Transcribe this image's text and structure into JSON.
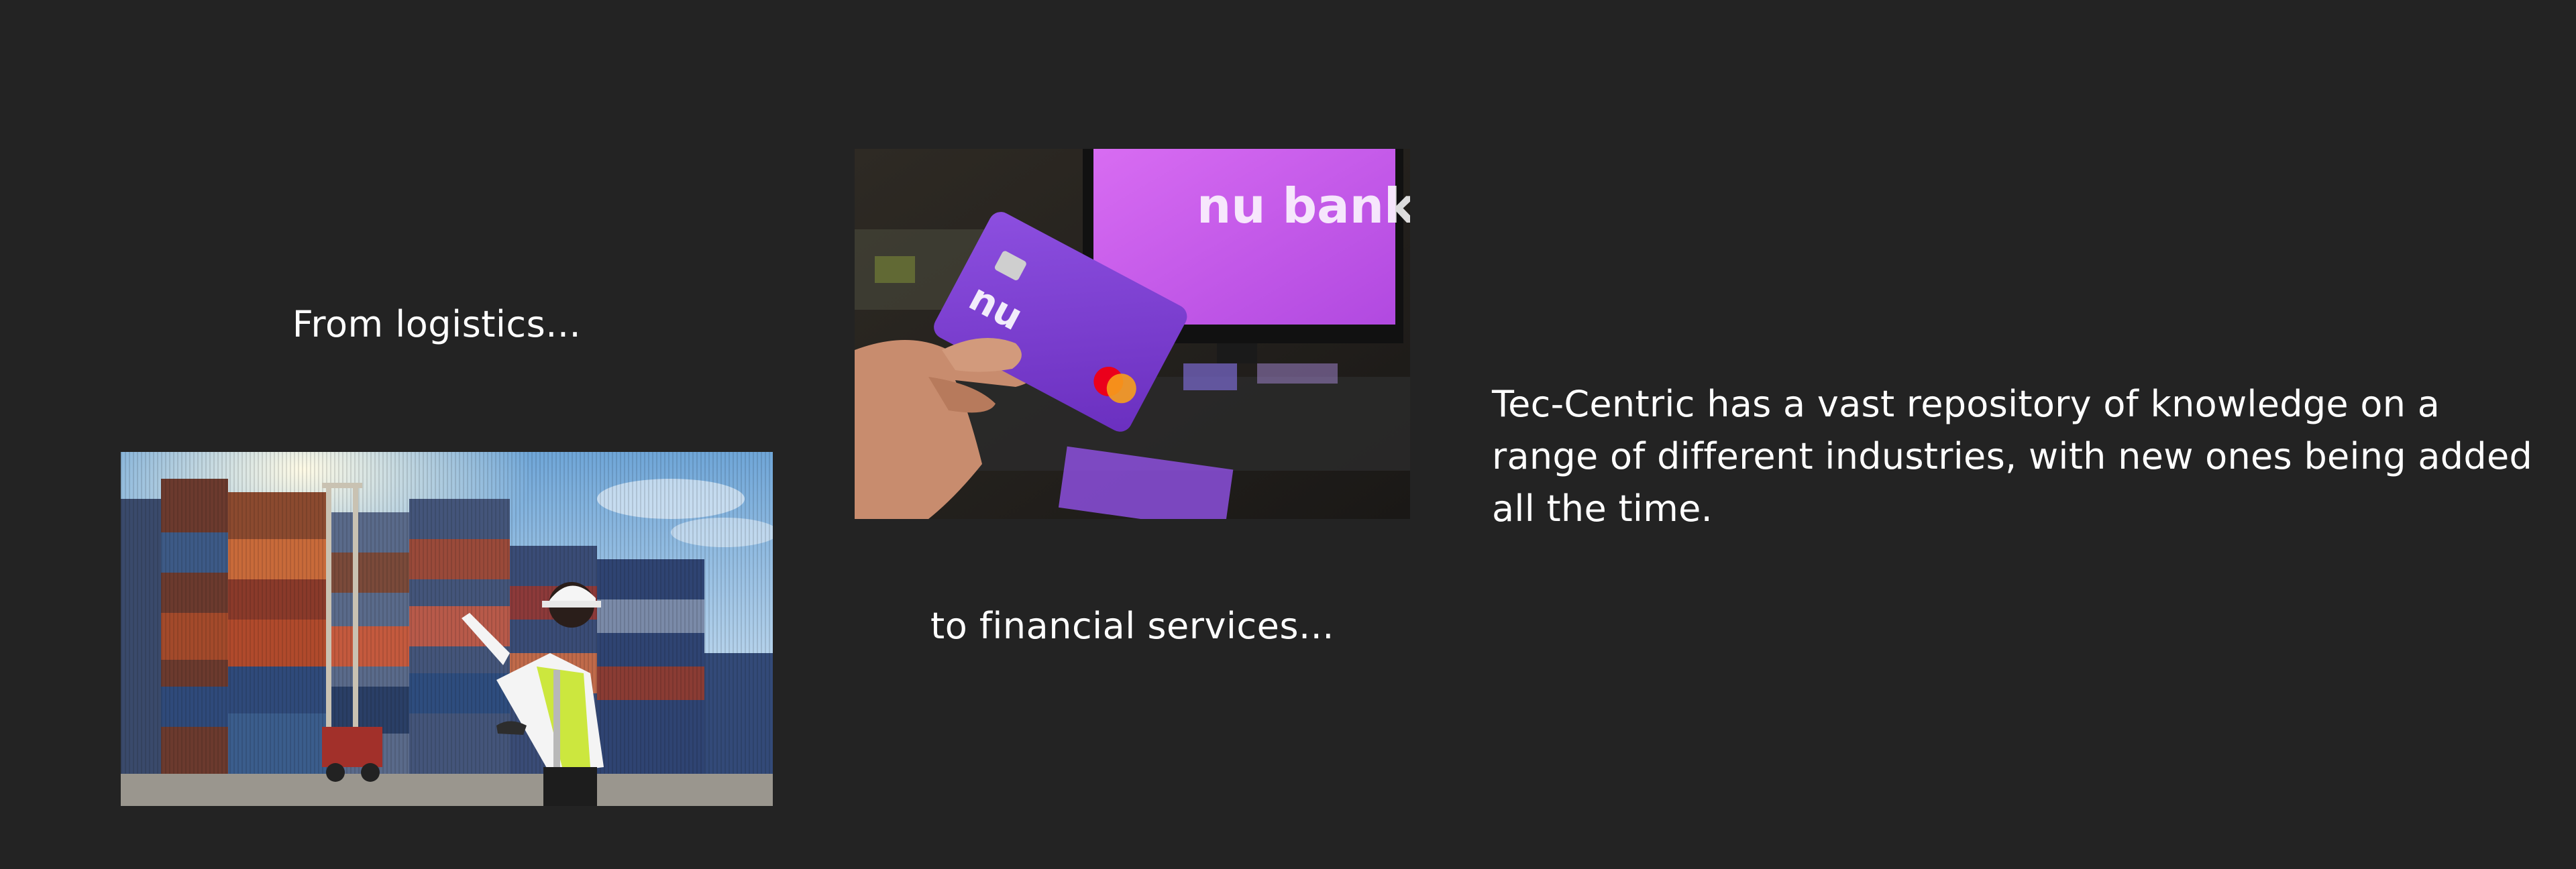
{
  "slide": {
    "caption_logistics": "From logistics...",
    "caption_financial": "to financial services...",
    "body_text": "Tec-Centric has a vast repository of knowledge on a range of different industries, with new ones being added all the time.",
    "background_color": "#232323",
    "text_color": "#ffffff"
  },
  "images": {
    "logistics": {
      "name": "logistics-photo",
      "depicts": "worker in hard hat and hi-vis vest pointing at stacked shipping containers"
    },
    "financial": {
      "name": "financial-photo",
      "depicts": "hand holding purple bank card in front of a monitor",
      "card_logo": "nu",
      "screen_logo": "nu bank"
    }
  }
}
